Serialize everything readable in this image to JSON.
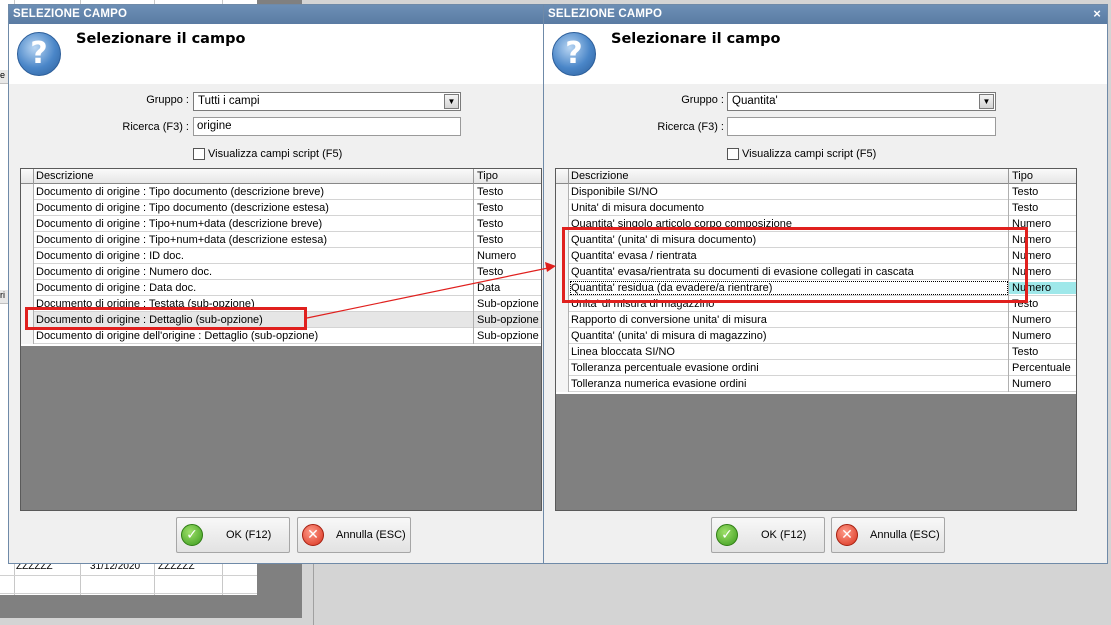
{
  "background": {
    "rows": [
      {
        "c1": "ZZZZZZ",
        "c2": "31/12/2020",
        "c3": "ZZZZZZ"
      }
    ],
    "side_labels": [
      "e",
      "ri"
    ]
  },
  "dialog_left": {
    "title": "SELEZIONE CAMPO",
    "heading": "Selezionare il campo",
    "group_label": "Gruppo :",
    "group_value": "Tutti i campi",
    "search_label": "Ricerca (F3) :",
    "search_value": "origine",
    "checkbox_label": "Visualizza campi script (F5)",
    "columns": [
      "Descrizione",
      "Tipo"
    ],
    "rows": [
      {
        "desc": "Documento di origine : Tipo documento (descrizione breve)",
        "type": "Testo"
      },
      {
        "desc": "Documento di origine : Tipo documento (descrizione estesa)",
        "type": "Testo"
      },
      {
        "desc": "Documento di origine : Tipo+num+data (descrizione breve)",
        "type": "Testo"
      },
      {
        "desc": "Documento di origine : Tipo+num+data (descrizione estesa)",
        "type": "Testo"
      },
      {
        "desc": "Documento di origine : ID doc.",
        "type": "Numero"
      },
      {
        "desc": "Documento di origine : Numero doc.",
        "type": "Testo"
      },
      {
        "desc": "Documento di origine : Data doc.",
        "type": "Data"
      },
      {
        "desc": "Documento di origine : Testata (sub-opzione)",
        "type": "Sub-opzione"
      },
      {
        "desc": "Documento di origine : Dettaglio (sub-opzione)",
        "type": "Sub-opzione"
      },
      {
        "desc": "Documento di origine dell'origine : Dettaglio (sub-opzione)",
        "type": "Sub-opzione"
      }
    ],
    "ok_label": "OK (F12)",
    "cancel_label": "Annulla (ESC)"
  },
  "dialog_right": {
    "title": "SELEZIONE CAMPO",
    "close_glyph": "×",
    "heading": "Selezionare il campo",
    "group_label": "Gruppo :",
    "group_value": "Quantita'",
    "search_label": "Ricerca (F3) :",
    "search_value": "",
    "checkbox_label": "Visualizza campi script (F5)",
    "columns": [
      "Descrizione",
      "Tipo"
    ],
    "rows": [
      {
        "desc": "Disponibile SI/NO",
        "type": "Testo"
      },
      {
        "desc": "Unita' di misura documento",
        "type": "Testo"
      },
      {
        "desc": "Quantita' singolo articolo corpo composizione",
        "type": "Numero"
      },
      {
        "desc": "Quantita' (unita' di misura documento)",
        "type": "Numero"
      },
      {
        "desc": "Quantita' evasa / rientrata",
        "type": "Numero"
      },
      {
        "desc": "Quantita' evasa/rientrata su documenti di evasione collegati in cascata",
        "type": "Numero"
      },
      {
        "desc": "Quantita' residua (da evadere/a rientrare)",
        "type": "Numero"
      },
      {
        "desc": "Unita' di misura di magazzino",
        "type": "Testo"
      },
      {
        "desc": "Rapporto di conversione unita' di misura",
        "type": "Numero"
      },
      {
        "desc": "Quantita' (unita' di misura di magazzino)",
        "type": "Numero"
      },
      {
        "desc": "Linea bloccata SI/NO",
        "type": "Testo"
      },
      {
        "desc": "Tolleranza percentuale evasione ordini",
        "type": "Percentuale"
      },
      {
        "desc": "Tolleranza numerica evasione ordini",
        "type": "Numero"
      }
    ],
    "ok_label": "OK (F12)",
    "cancel_label": "Annulla (ESC)"
  },
  "colors": {
    "title_bar": "#5a7ba3",
    "annotation_red": "#e0201e",
    "highlight_cell": "#9fe8ea"
  }
}
